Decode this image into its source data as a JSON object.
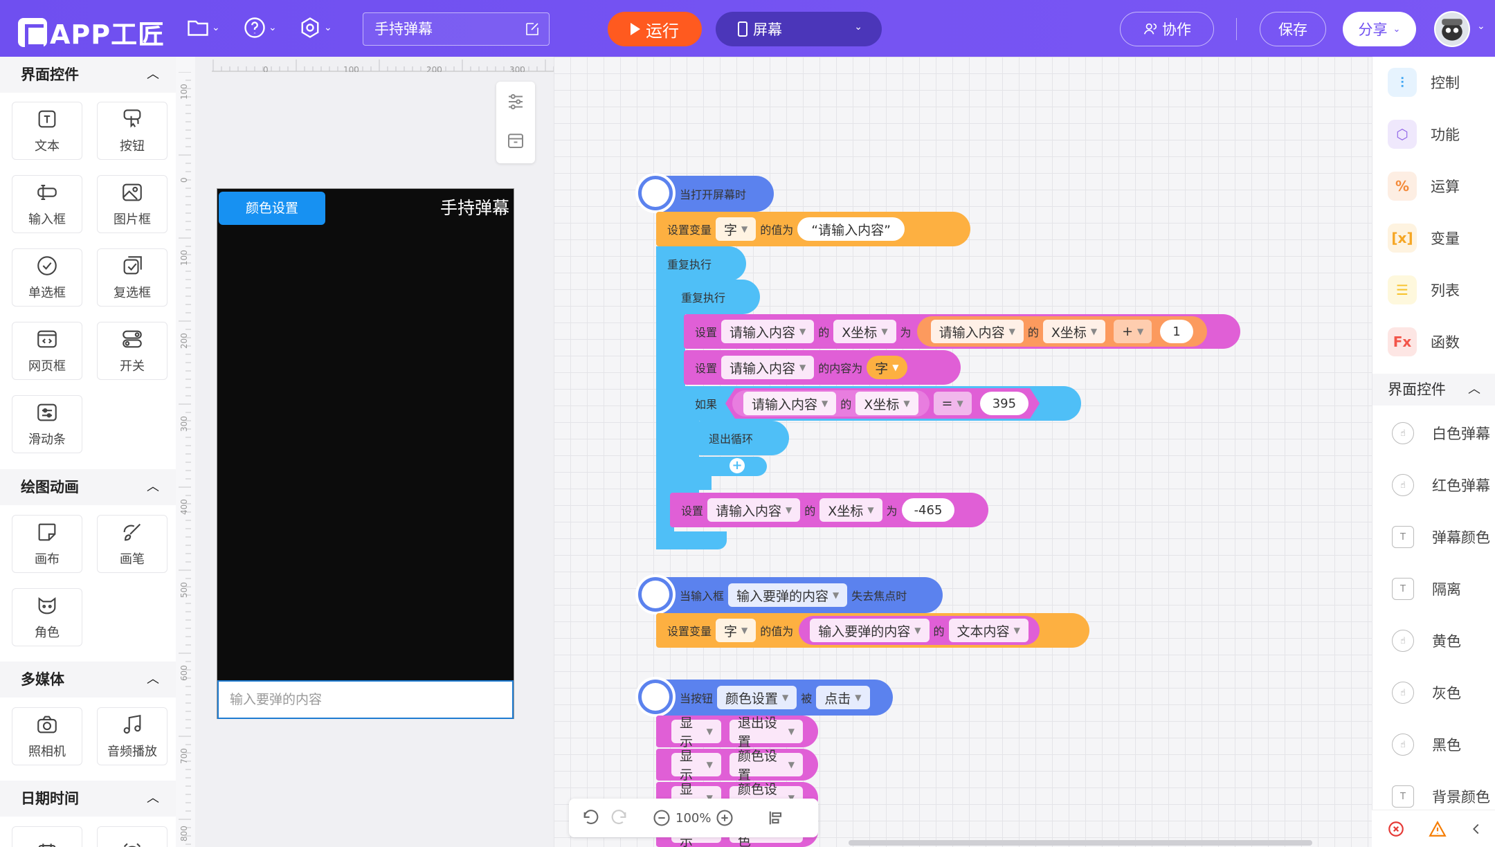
{
  "app": {
    "logo_text": "APP工匠",
    "project_name": "手持弹幕"
  },
  "toolbar": {
    "run_label": "运行",
    "screen_label": "屏幕",
    "collab_label": "协作",
    "save_label": "保存",
    "share_label": "分享"
  },
  "left_panel": {
    "sections": [
      {
        "title": "界面控件",
        "items": [
          "文本",
          "按钮",
          "输入框",
          "图片框",
          "单选框",
          "复选框",
          "网页框",
          "开关",
          "滑动条"
        ]
      },
      {
        "title": "绘图动画",
        "items": [
          "画布",
          "画笔",
          "角色"
        ]
      },
      {
        "title": "多媒体",
        "items": [
          "照相机",
          "音频播放"
        ]
      },
      {
        "title": "日期时间",
        "items": []
      }
    ]
  },
  "ruler": {
    "h_ticks": [
      "0",
      "100",
      "200",
      "300"
    ],
    "v_ticks": [
      "100",
      "0",
      "100",
      "200",
      "300",
      "400",
      "500",
      "600",
      "700",
      "800"
    ]
  },
  "phone": {
    "color_button": "颜色设置",
    "title": "手持弹幕",
    "input_placeholder": "输入要弹的内容"
  },
  "blocks": {
    "event1": {
      "label": "当打开屏幕时",
      "set_var": "设置变量",
      "var_name": "字",
      "value_of": "的值为",
      "string_value": "“请输入内容”",
      "repeat_outer": "重复执行",
      "repeat_inner": "重复执行",
      "set1": {
        "set": "设置",
        "target": "请输入内容",
        "of": "的",
        "prop": "X坐标",
        "to": "为",
        "rhs_target": "请输入内容",
        "rhs_of": "的",
        "rhs_prop": "X坐标",
        "op": "+",
        "num": "1"
      },
      "set2": {
        "set": "设置",
        "target": "请输入内容",
        "prop_text": "的内容为",
        "val": "字"
      },
      "if": {
        "label": "如果",
        "target": "请输入内容",
        "of": "的",
        "prop": "X坐标",
        "op": "=",
        "num": "395"
      },
      "break_label": "退出循环",
      "plus": "+",
      "set3": {
        "set": "设置",
        "target": "请输入内容",
        "of": "的",
        "prop": "X坐标",
        "to": "为",
        "num": "-465"
      }
    },
    "event2": {
      "when": "当输入框",
      "target": "输入要弹的内容",
      "event": "失去焦点时",
      "set_var": "设置变量",
      "var_name": "字",
      "value_of": "的值为",
      "src": "输入要弹的内容",
      "of": "的",
      "prop": "文本内容"
    },
    "event3": {
      "when": "当按钮",
      "target": "颜色设置",
      "by": "被",
      "event": "点击",
      "rows": [
        {
          "action": "显示",
          "target": "退出设置"
        },
        {
          "action": "显示",
          "target": "颜色设置"
        },
        {
          "action": "显示",
          "target": "颜色设置"
        },
        {
          "action": "显示",
          "target": "背景颜色"
        }
      ]
    }
  },
  "bottom_tools": {
    "zoom": "100%"
  },
  "right_panel": {
    "categories": [
      {
        "label": "控制",
        "color": "#3aa4f2"
      },
      {
        "label": "功能",
        "color": "#8f63e8"
      },
      {
        "label": "运算",
        "color": "#f38a3a"
      },
      {
        "label": "变量",
        "color": "#f5a623"
      },
      {
        "label": "列表",
        "color": "#f7c22b"
      },
      {
        "label": "函数",
        "color": "#f2554a"
      }
    ],
    "section_title": "界面控件",
    "items": [
      "白色弹幕",
      "红色弹幕",
      "弹幕颜色",
      "隔离",
      "黄色",
      "灰色",
      "黑色",
      "背景颜色"
    ]
  }
}
